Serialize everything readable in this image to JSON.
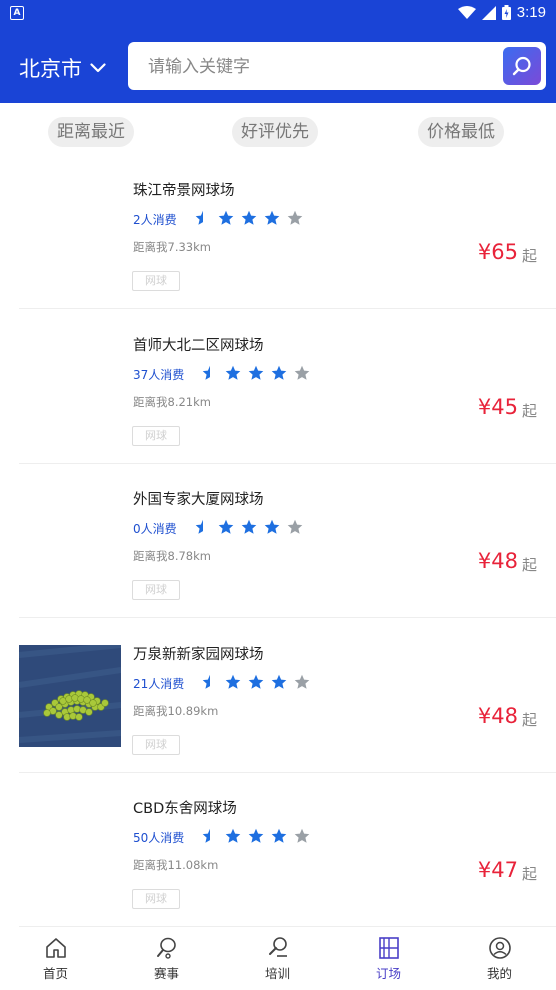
{
  "statusbar": {
    "app_icon": "A",
    "time": "3:19"
  },
  "header": {
    "city": "北京市",
    "search_placeholder": "请输入关键字"
  },
  "sort_options": [
    "距离最近",
    "好评优先",
    "价格最低"
  ],
  "venues": [
    {
      "name": "珠江帝景网球场",
      "count": "2人消费",
      "rating": 4,
      "distance": "距离我7.33km",
      "tag": "网球",
      "price": "¥65",
      "suffix": "起",
      "has_image": false
    },
    {
      "name": "首师大北二区网球场",
      "count": "37人消费",
      "rating": 4,
      "distance": "距离我8.21km",
      "tag": "网球",
      "price": "¥45",
      "suffix": "起",
      "has_image": false
    },
    {
      "name": "外国专家大厦网球场",
      "count": "0人消费",
      "rating": 4,
      "distance": "距离我8.78km",
      "tag": "网球",
      "price": "¥48",
      "suffix": "起",
      "has_image": false
    },
    {
      "name": "万泉新新家园网球场",
      "count": "21人消费",
      "rating": 4,
      "distance": "距离我10.89km",
      "tag": "网球",
      "price": "¥48",
      "suffix": "起",
      "has_image": true
    },
    {
      "name": "CBD东舍网球场",
      "count": "50人消费",
      "rating": 4,
      "distance": "距离我11.08km",
      "tag": "网球",
      "price": "¥47",
      "suffix": "起",
      "has_image": false
    }
  ],
  "nav": [
    {
      "label": "首页",
      "icon": "home-icon",
      "active": false
    },
    {
      "label": "赛事",
      "icon": "racket-icon",
      "active": false
    },
    {
      "label": "培训",
      "icon": "training-icon",
      "active": false
    },
    {
      "label": "订场",
      "icon": "court-icon",
      "active": true
    },
    {
      "label": "我的",
      "icon": "profile-icon",
      "active": false
    }
  ],
  "colors": {
    "primary": "#1a44d6",
    "price": "#e8233a",
    "star": "#1e6fe0",
    "nav_active": "#4a3fc7"
  }
}
